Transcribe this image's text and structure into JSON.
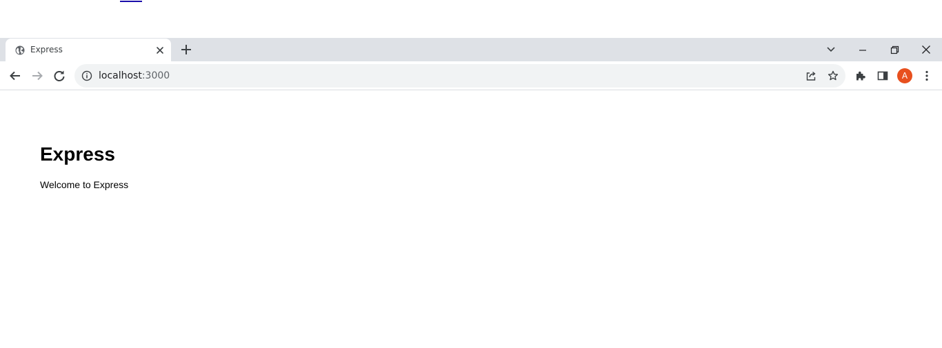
{
  "tab": {
    "title": "Express"
  },
  "toolbar": {
    "url_host": "localhost",
    "url_port": ":3000",
    "profile_initial": "A",
    "profile_color": "#e8501e"
  },
  "icons": {
    "favicon": "globe-icon",
    "tab_close": "close-icon",
    "new_tab": "plus-icon",
    "tab_search": "chevron-down-icon",
    "minimize": "minimize-icon",
    "restore": "restore-icon",
    "window_close": "close-icon",
    "back": "arrow-left-icon",
    "forward": "arrow-right-icon",
    "reload": "reload-icon",
    "site_info": "info-icon",
    "share": "share-icon",
    "bookmark": "star-icon",
    "extensions": "puzzle-icon",
    "side_panel": "side-panel-icon",
    "menu": "kebab-menu-icon"
  },
  "page": {
    "heading": "Express",
    "body_text": "Welcome to Express"
  }
}
